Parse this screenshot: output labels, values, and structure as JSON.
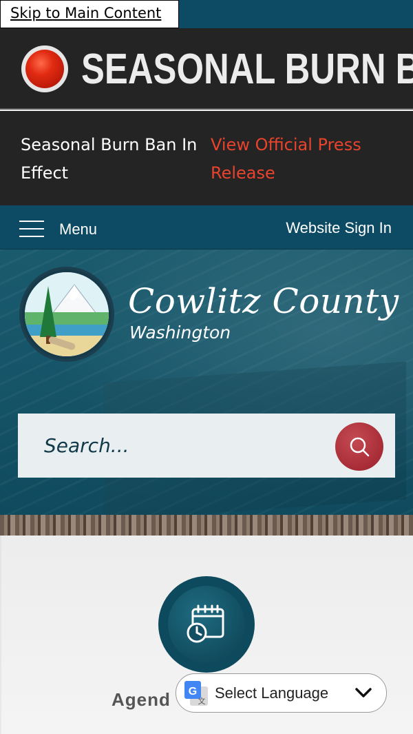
{
  "skip_link": "Skip to Main Content",
  "alert": {
    "title": "SEASONAL BURN BAN",
    "message": "Seasonal Burn Ban In Effect",
    "link_text": "View Official Press Release",
    "link_color": "#e8442d"
  },
  "nav": {
    "menu_label": "Menu",
    "signin_label": "Website Sign In"
  },
  "branding": {
    "county": "Cowlitz County",
    "state": "Washington"
  },
  "search": {
    "placeholder": "Search..."
  },
  "quick_link": {
    "label": "Agend",
    "icon": "calendar-clock-icon"
  },
  "translate": {
    "label": "Select Language",
    "icon": "google-translate-icon"
  },
  "colors": {
    "brand_teal": "#0c4b63",
    "alert_red": "#e12b12",
    "search_button": "#9c1f2b"
  }
}
